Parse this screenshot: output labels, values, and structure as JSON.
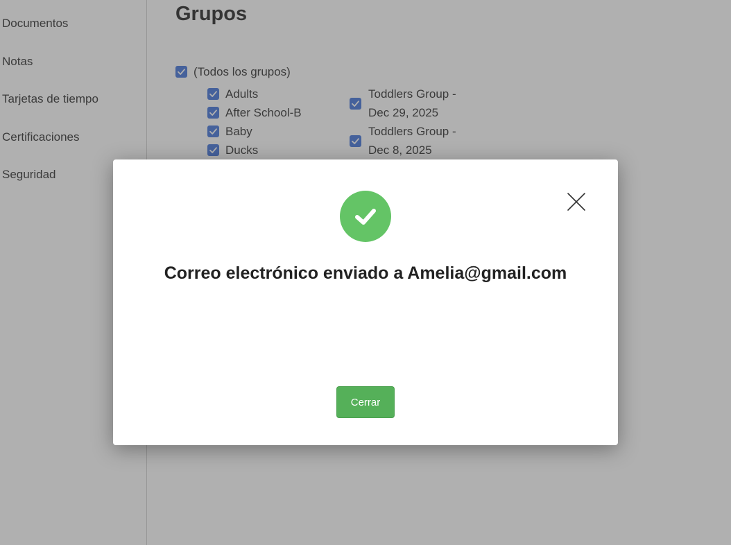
{
  "sidebar": {
    "items": [
      {
        "label": "Documentos"
      },
      {
        "label": "Notas"
      },
      {
        "label": "Tarjetas de tiempo"
      },
      {
        "label": "Certificaciones"
      },
      {
        "label": "Seguridad"
      }
    ]
  },
  "main": {
    "title": "Grupos",
    "all_groups": {
      "label": "(Todos los grupos)",
      "checked": true
    },
    "groups_col1": [
      {
        "label": "Adults",
        "checked": true
      },
      {
        "label": "After School-B",
        "checked": true
      },
      {
        "label": "Baby",
        "checked": true
      },
      {
        "label": "Ducks",
        "checked": true
      }
    ],
    "groups_col2": [
      {
        "line1": "Toddlers Group -",
        "line2": "Dec 29, 2025",
        "checked": true
      },
      {
        "line1": "Toddlers Group -",
        "line2": "Dec 8, 2025",
        "checked": true
      }
    ]
  },
  "modal": {
    "icon": "check-circle-icon",
    "close_icon": "close-icon",
    "message": "Correo electrónico enviado a Amelia@gmail.com",
    "button_label": "Cerrar"
  },
  "colors": {
    "checkbox": "#3d6fd9",
    "success": "#64c466",
    "button": "#55b059",
    "overlay": "rgba(80,80,80,0.45)"
  }
}
